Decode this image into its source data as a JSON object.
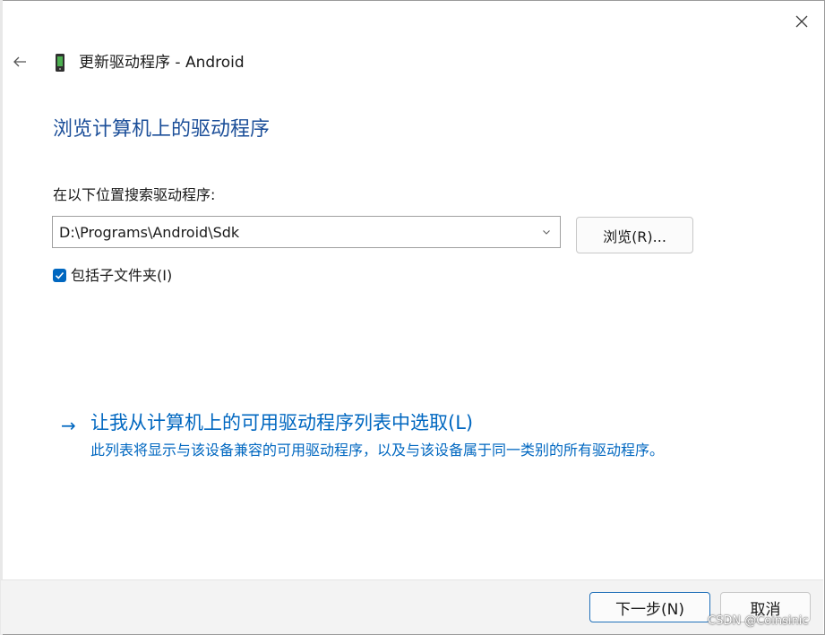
{
  "window": {
    "header_title": "更新驱动程序 - Android",
    "device_icon": "phone-device-icon",
    "back_icon": "arrow-left-icon",
    "close_icon": "close-icon"
  },
  "main": {
    "page_title": "浏览计算机上的驱动程序",
    "search_label": "在以下位置搜索驱动程序:",
    "path_value": "D:\\Programs\\Android\\Sdk",
    "browse_label": "浏览(R)...",
    "include_subfolders": {
      "checked": true,
      "label": "包括子文件夹(I)"
    },
    "pick_link": {
      "arrow": "→",
      "label": "让我从计算机上的可用驱动程序列表中选取(L)",
      "description": "此列表将显示与该设备兼容的可用驱动程序，以及与该设备属于同一类别的所有驱动程序。"
    }
  },
  "footer": {
    "next_label": "下一步(N)",
    "cancel_label": "取消"
  },
  "watermark": "CSDN @Coinsinic",
  "colors": {
    "title_blue": "#1c4f99",
    "link_blue": "#0067c0",
    "accent": "#0067c0",
    "footer_bg": "#f3f3f3"
  }
}
